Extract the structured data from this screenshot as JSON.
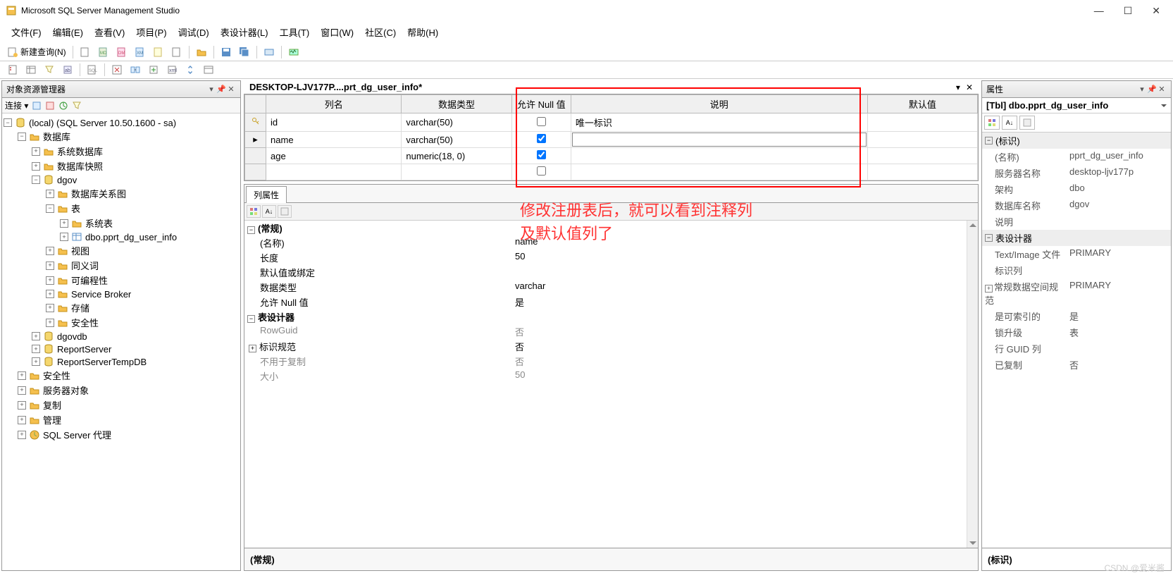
{
  "app": {
    "title": "Microsoft SQL Server Management Studio"
  },
  "menu": {
    "file": "文件(F)",
    "edit": "编辑(E)",
    "view": "查看(V)",
    "project": "项目(P)",
    "debug": "调试(D)",
    "table_designer": "表设计器(L)",
    "tools": "工具(T)",
    "window": "窗口(W)",
    "community": "社区(C)",
    "help": "帮助(H)"
  },
  "toolbar": {
    "new_query": "新建查询(N)"
  },
  "object_explorer": {
    "title": "对象资源管理器",
    "connect_label": "连接 ▾",
    "root": "(local) (SQL Server 10.50.1600 - sa)",
    "nodes": {
      "databases": "数据库",
      "system_databases": "系统数据库",
      "db_snapshot": "数据库快照",
      "dgov": "dgov",
      "db_diagrams": "数据库关系图",
      "tables": "表",
      "system_tables": "系统表",
      "user_info_table": "dbo.pprt_dg_user_info",
      "views": "视图",
      "synonyms": "同义词",
      "programmability": "可编程性",
      "service_broker": "Service Broker",
      "storage": "存储",
      "security_node": "安全性",
      "dgovdb": "dgovdb",
      "report_server": "ReportServer",
      "report_server_temp": "ReportServerTempDB",
      "security": "安全性",
      "server_objects": "服务器对象",
      "replication": "复制",
      "management": "管理",
      "sql_agent": "SQL Server 代理"
    }
  },
  "designer": {
    "tab_title": "DESKTOP-LJV177P....prt_dg_user_info*",
    "headers": {
      "col_name": "列名",
      "data_type": "数据类型",
      "allow_null": "允许 Null 值",
      "description": "说明",
      "default_value": "默认值"
    },
    "rows": [
      {
        "name": "id",
        "type": "varchar(50)",
        "allow_null": false,
        "desc": "唯一标识",
        "default": "",
        "is_key": true
      },
      {
        "name": "name",
        "type": "varchar(50)",
        "allow_null": true,
        "desc": "",
        "default": "",
        "is_selected": true
      },
      {
        "name": "age",
        "type": "numeric(18, 0)",
        "allow_null": true,
        "desc": "",
        "default": ""
      }
    ]
  },
  "annotation": {
    "line1": "修改注册表后，就可以看到注释列",
    "line2": "及默认值列了"
  },
  "column_properties": {
    "tab_label": "列属性",
    "sections": {
      "general": "(常规)",
      "table_designer": "表设计器"
    },
    "rows": {
      "name_label": "(名称)",
      "name_value": "name",
      "length_label": "长度",
      "length_value": "50",
      "default_label": "默认值或绑定",
      "default_value": "",
      "datatype_label": "数据类型",
      "datatype_value": "varchar",
      "allow_null_label": "允许 Null 值",
      "allow_null_value": "是",
      "rowguid_label": "RowGuid",
      "rowguid_value": "否",
      "identity_label": "标识规范",
      "identity_value": "否",
      "not_for_repl_label": "不用于复制",
      "not_for_repl_value": "否",
      "size_label": "大小",
      "size_value": "50"
    },
    "footer": "(常规)"
  },
  "properties_panel": {
    "title": "属性",
    "object_label": "[Tbl] dbo.pprt_dg_user_info",
    "sections": {
      "identification": "(标识)",
      "table_designer": "表设计器"
    },
    "rows": {
      "name_label": "(名称)",
      "name_value": "pprt_dg_user_info",
      "server_label": "服务器名称",
      "server_value": "desktop-ljv177p",
      "schema_label": "架构",
      "schema_value": "dbo",
      "db_label": "数据库名称",
      "db_value": "dgov",
      "desc_label": "说明",
      "desc_value": "",
      "textimage_label": "Text/Image 文件",
      "textimage_value": "PRIMARY",
      "identity_col_label": "标识列",
      "identity_col_value": "",
      "regular_dataspace_label": "常规数据空间规范",
      "regular_dataspace_value": "PRIMARY",
      "indexable_label": "是可索引的",
      "indexable_value": "是",
      "lock_escalation_label": "锁升级",
      "lock_escalation_value": "表",
      "rowguid_label": "行 GUID 列",
      "rowguid_value": "",
      "replicated_label": "已复制",
      "replicated_value": "否"
    },
    "footer": "(标识)"
  },
  "watermark": "CSDN @爱米酱"
}
